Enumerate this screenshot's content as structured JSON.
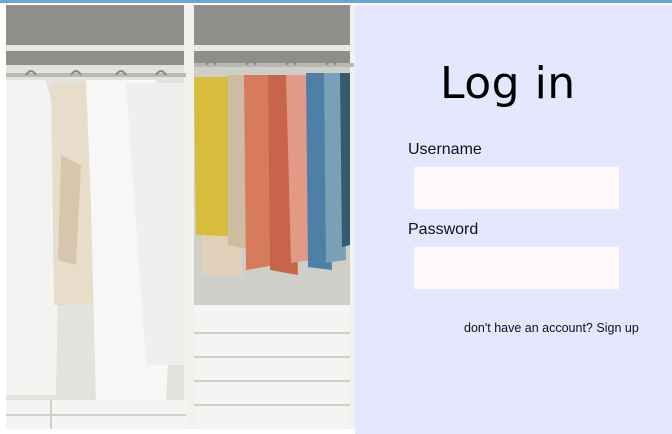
{
  "login": {
    "title": "Log in",
    "username_label": "Username",
    "password_label": "Password",
    "username_value": "",
    "password_value": "",
    "signup_prompt": "don't have an account?",
    "signup_link": "Sign up"
  },
  "colors": {
    "panel_background": "#e6e6ff",
    "field_background": "#fff8f8",
    "top_border": "#6aa7d8"
  },
  "image": {
    "subject": "wardrobe-with-hanging-clothes"
  }
}
